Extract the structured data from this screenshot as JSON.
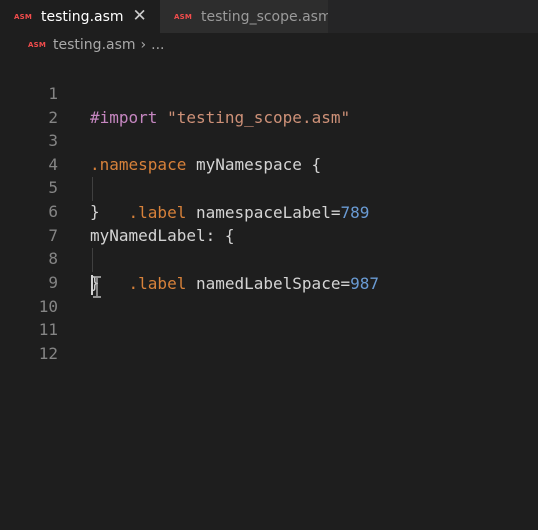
{
  "tabs": [
    {
      "label": "testing.asm",
      "icon": "ASM",
      "active": true,
      "close": "✕"
    },
    {
      "label": "testing_scope.asm",
      "icon": "ASM",
      "active": false
    }
  ],
  "breadcrumb": {
    "icon": "ASM",
    "file": "testing.asm",
    "separator": "›",
    "more": "..."
  },
  "colors": {
    "background": "#1e1e1e",
    "directive": "#c586c0",
    "string": "#ce9178",
    "keyword": "#d7813a",
    "number": "#6a9bd4",
    "asm_icon": "#f14c4c"
  },
  "editor": {
    "lines": [
      {
        "num": "1",
        "t1": "#import",
        "t2": " ",
        "t3": "\"testing_scope.asm\""
      },
      {
        "num": "2"
      },
      {
        "num": "3",
        "t1": ".namespace",
        "t2": " myNamespace {"
      },
      {
        "num": "4",
        "indent": "    ",
        "t1": ".label",
        "t2": " namespaceLabel=",
        "t3": "789"
      },
      {
        "num": "5",
        "t1": "}"
      },
      {
        "num": "6",
        "t1": "myNamedLabel: {"
      },
      {
        "num": "7",
        "indent": "    ",
        "t1": ".label",
        "t2": " namedLabelSpace=",
        "t3": "987"
      },
      {
        "num": "8",
        "t1": "}"
      },
      {
        "num": "9"
      },
      {
        "num": "10"
      },
      {
        "num": "11"
      },
      {
        "num": "12"
      }
    ]
  }
}
